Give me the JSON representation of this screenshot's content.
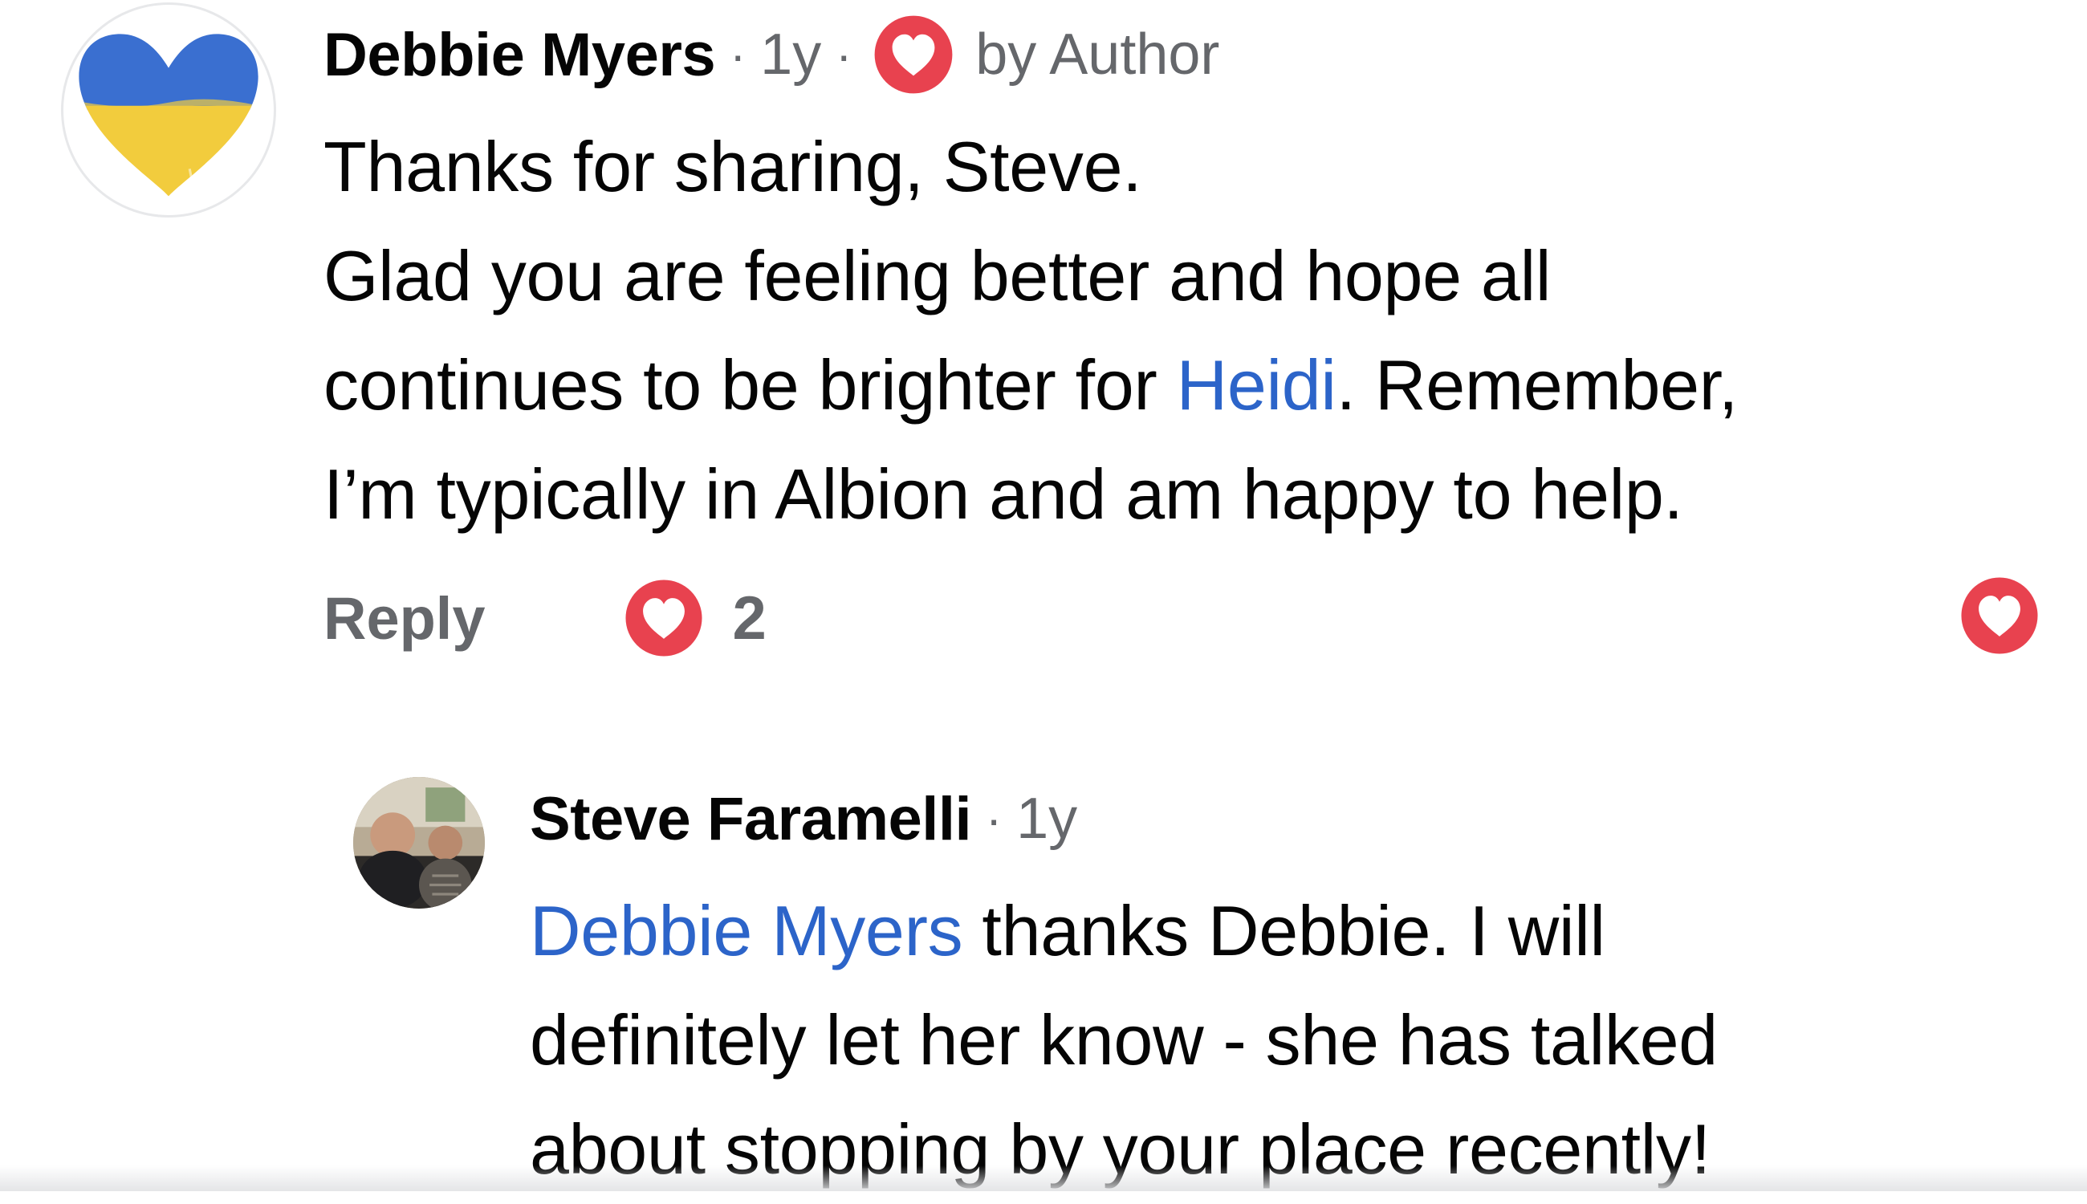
{
  "comments": [
    {
      "author": "Debbie Myers",
      "time": "1y",
      "badge_label": "by Author",
      "body": {
        "line1": "Thanks for sharing, Steve.",
        "line2": "Glad you are feeling better and hope all",
        "line3_before": "continues to be brighter for ",
        "line3_mention": "Heidi",
        "line3_after": ". Remember,",
        "line4": "I’m typically in Albion and am happy to help."
      },
      "actions": {
        "reply_label": "Reply",
        "reaction_count": "2"
      }
    },
    {
      "author": "Steve Faramelli",
      "time": "1y",
      "body": {
        "line1_mention": "Debbie Myers",
        "line1_after": " thanks Debbie. I will",
        "line2": "definitely let her know - she has talked",
        "line3": "about stopping by your place recently!"
      }
    }
  ],
  "colors": {
    "mention": "#2c64c9",
    "secondary_text": "#65676b",
    "love_reaction": "#e8424f"
  },
  "icons": {
    "avatar1": "ukraine-heart-avatar",
    "author_badge": "love-reaction-icon",
    "reaction": "love-reaction-icon",
    "like_button": "love-reaction-icon"
  }
}
